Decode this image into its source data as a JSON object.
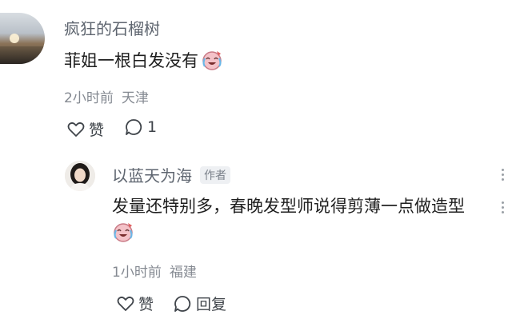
{
  "comment": {
    "username": "疯狂的石榴树",
    "text": "菲姐一根白发没有",
    "time": "2小时前",
    "location": "天津",
    "like_label": "赞",
    "reply_count": "1"
  },
  "reply": {
    "username": "以蓝天为海",
    "badge": "作者",
    "text": "发量还特别多，春晚发型师说得剪薄一点做造型",
    "time": "1小时前",
    "location": "福建",
    "like_label": "赞",
    "reply_label": "回复"
  },
  "icons": {
    "emoji": "crying-laughing-emoji",
    "like": "heart-outline",
    "comment": "speech-bubble-outline",
    "more": "vertical-dots"
  }
}
